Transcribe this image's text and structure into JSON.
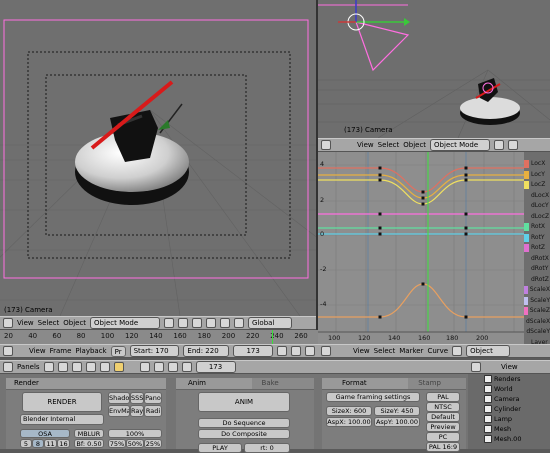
{
  "viewport_left": {
    "status": "(173) Camera"
  },
  "viewport_right": {
    "status": "(173) Camera"
  },
  "header_left": {
    "view": "View",
    "select": "Select",
    "object": "Object",
    "mode": "Object Mode",
    "orientation": "Global"
  },
  "header_right": {
    "view": "View",
    "select": "Select",
    "object": "Object",
    "mode": "Object Mode"
  },
  "ipo": {
    "y_ticks": [
      "4",
      "2",
      "0",
      "-2",
      "-4"
    ],
    "x_ticks": [
      "100",
      "120",
      "140",
      "160",
      "180",
      "200"
    ],
    "channels": [
      {
        "name": "LocX",
        "color": "#e07060"
      },
      {
        "name": "LocY",
        "color": "#e8b040"
      },
      {
        "name": "LocZ",
        "color": "#f0e060"
      },
      {
        "name": "dLocX",
        "color": null
      },
      {
        "name": "dLocY",
        "color": null
      },
      {
        "name": "dLocZ",
        "color": null
      },
      {
        "name": "RotX",
        "color": "#60e0a0"
      },
      {
        "name": "RotY",
        "color": "#60d0e8"
      },
      {
        "name": "RotZ",
        "color": "#e070d0"
      },
      {
        "name": "dRotX",
        "color": null
      },
      {
        "name": "dRotY",
        "color": null
      },
      {
        "name": "dRotZ",
        "color": null
      },
      {
        "name": "ScaleX",
        "color": "#c080e0"
      },
      {
        "name": "ScaleY",
        "color": "#c0c0f0"
      },
      {
        "name": "ScaleZ",
        "color": "#f070c0"
      },
      {
        "name": "dScaleX",
        "color": null
      },
      {
        "name": "dScaleY",
        "color": null
      },
      {
        "name": "Layer",
        "color": null
      }
    ],
    "header": {
      "view": "View",
      "select": "Select",
      "marker": "Marker",
      "curve": "Curve",
      "object": "Object"
    }
  },
  "timeline": {
    "ticks": [
      "20",
      "40",
      "60",
      "80",
      "100",
      "120",
      "140",
      "160",
      "180",
      "200",
      "220",
      "240",
      "260"
    ],
    "view": "View",
    "frame": "Frame",
    "playback": "Playback",
    "pr": "Pr",
    "start": "Start: 170",
    "end": "End: 220",
    "current": "173"
  },
  "buttons_header": {
    "panels": "Panels",
    "frame": "173"
  },
  "render_panel": {
    "tab_render": "Render",
    "render_btn": "RENDER",
    "renderer": "Blender Internal",
    "shadow": "Shado",
    "sss": "SSS",
    "pano": "Pano",
    "envmap": "EnvMa",
    "ray": "Ray",
    "radio": "Radi",
    "osa": "OSA",
    "mblur": "MBLUR",
    "pct100": "100%",
    "osa_vals": [
      "5",
      "8",
      "11",
      "16"
    ],
    "bf": "Bf: 0.50",
    "pcts": [
      "75%",
      "50%",
      "25%"
    ]
  },
  "anim_panel": {
    "tab_anim": "Anim",
    "tab_bake": "Bake",
    "anim_btn": "ANIM",
    "do_sequence": "Do Sequence",
    "do_composite": "Do Composite",
    "play": "PLAY",
    "rt": "rt: 0"
  },
  "format_panel": {
    "tab_format": "Format",
    "tab_stamp": "Stamp",
    "framing": "Game framing settings",
    "sizex": "SizeX: 600",
    "sizey": "SizeY: 450",
    "aspx": "AspX: 100.00",
    "aspy": "AspY: 100.00",
    "presets": [
      "PAL",
      "NTSC",
      "Default",
      "Preview",
      "PC",
      "PAL 16:9"
    ]
  },
  "outliner": {
    "view": "View",
    "items": [
      {
        "label": "Renders"
      },
      {
        "label": "World"
      },
      {
        "label": "Camera"
      },
      {
        "label": "Cylinder"
      },
      {
        "label": "Lamp"
      },
      {
        "label": "Mesh"
      },
      {
        "label": "Mesh.00"
      }
    ]
  },
  "colors": {
    "selection": "#ff6fe0",
    "current_frame": "#3ae03a",
    "x_axis": "#c83a3a",
    "y_axis": "#3ac83a"
  }
}
